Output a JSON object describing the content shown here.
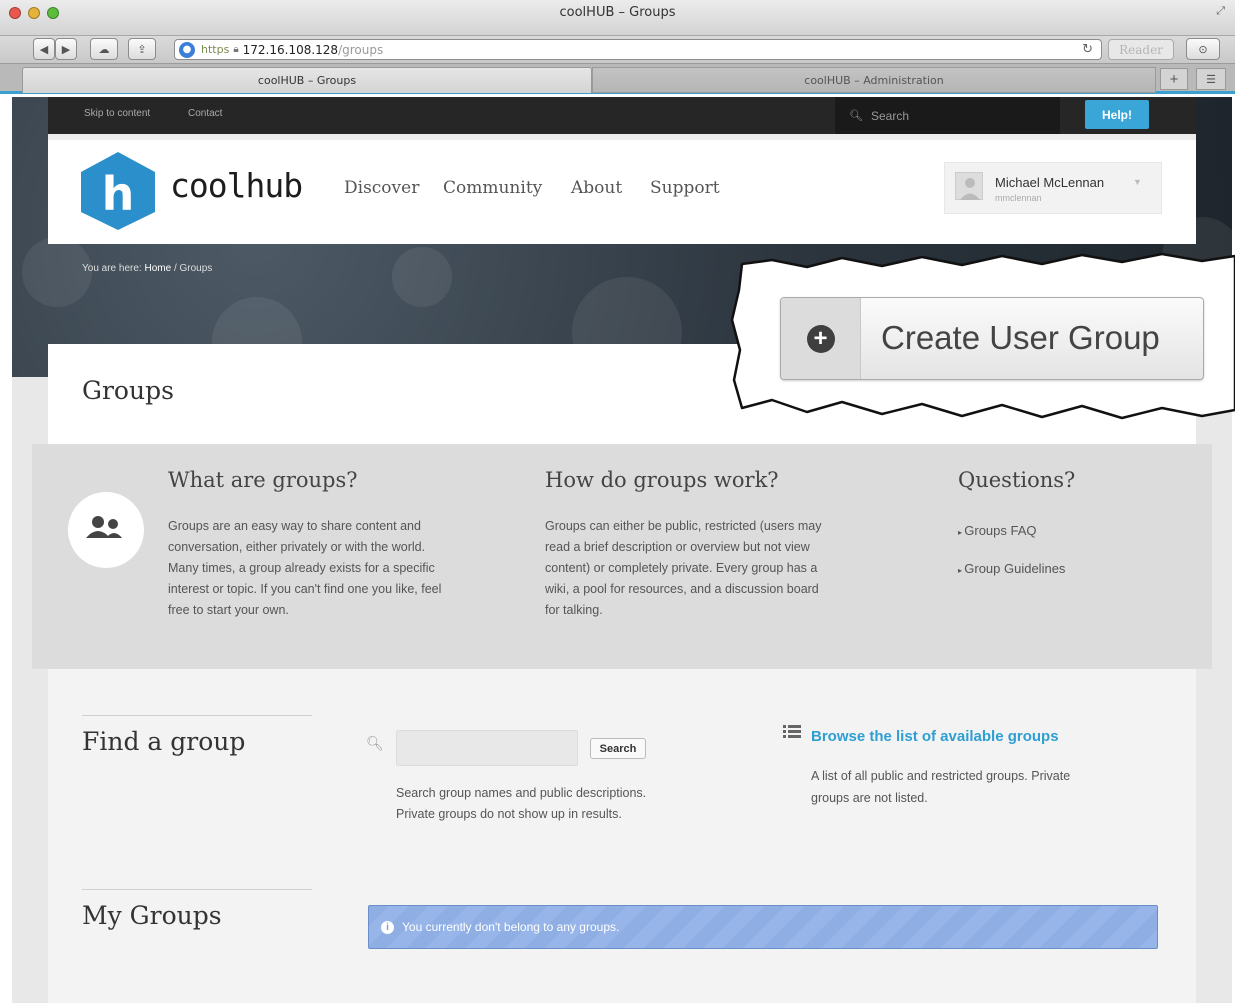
{
  "window": {
    "title": "coolHUB – Groups"
  },
  "address_bar": {
    "protocol": "https",
    "host": "172.16.108.128",
    "path": "/groups",
    "reader_label": "Reader"
  },
  "tabs": [
    {
      "label": "coolHUB – Groups"
    },
    {
      "label": "coolHUB – Administration"
    }
  ],
  "utility": {
    "skip_label": "Skip to content",
    "contact_label": "Contact",
    "search_placeholder": "Search",
    "help_label": "Help!"
  },
  "header": {
    "logo_letter": "h",
    "logo_text": "coolhub",
    "nav": [
      "Discover",
      "Community",
      "About",
      "Support"
    ],
    "user_name": "Michael McLennan",
    "user_login": "mmclennan"
  },
  "breadcrumb": {
    "prefix": "You are here:",
    "home": "Home",
    "sep": "/",
    "current": "Groups"
  },
  "page": {
    "title": "Groups"
  },
  "info": {
    "what_title": "What are groups?",
    "what_lines": [
      "Groups are an easy way to share content and",
      "conversation, either privately or with the world.",
      "Many times, a group already exists for a specific",
      "interest or topic. If you can't find one you like, feel",
      "free to start your own."
    ],
    "how_title": "How do groups work?",
    "how_lines": [
      "Groups can either be public, restricted (users may",
      "read a brief description or overview but not view",
      "content) or completely private. Every group has a",
      "wiki, a pool for resources, and a discussion board",
      "for talking."
    ],
    "questions_title": "Questions?",
    "question_links": [
      "Groups FAQ",
      "Group Guidelines"
    ]
  },
  "find": {
    "title": "Find a group",
    "search_value": "",
    "search_button": "Search",
    "help_lines": [
      "Search group names and public descriptions.",
      "Private groups do not show up in results."
    ],
    "browse_link": "Browse the list of available groups",
    "browse_lines": [
      "A list of all public and restricted groups. Private",
      "groups are not listed."
    ]
  },
  "my_groups": {
    "title": "My Groups",
    "alert": "You currently don't belong to any groups."
  },
  "callout": {
    "button_label": "Create User Group"
  },
  "colors": {
    "accent": "#3aa5d7",
    "logo": "#2b8fcb",
    "alert": "#8eaee4"
  }
}
